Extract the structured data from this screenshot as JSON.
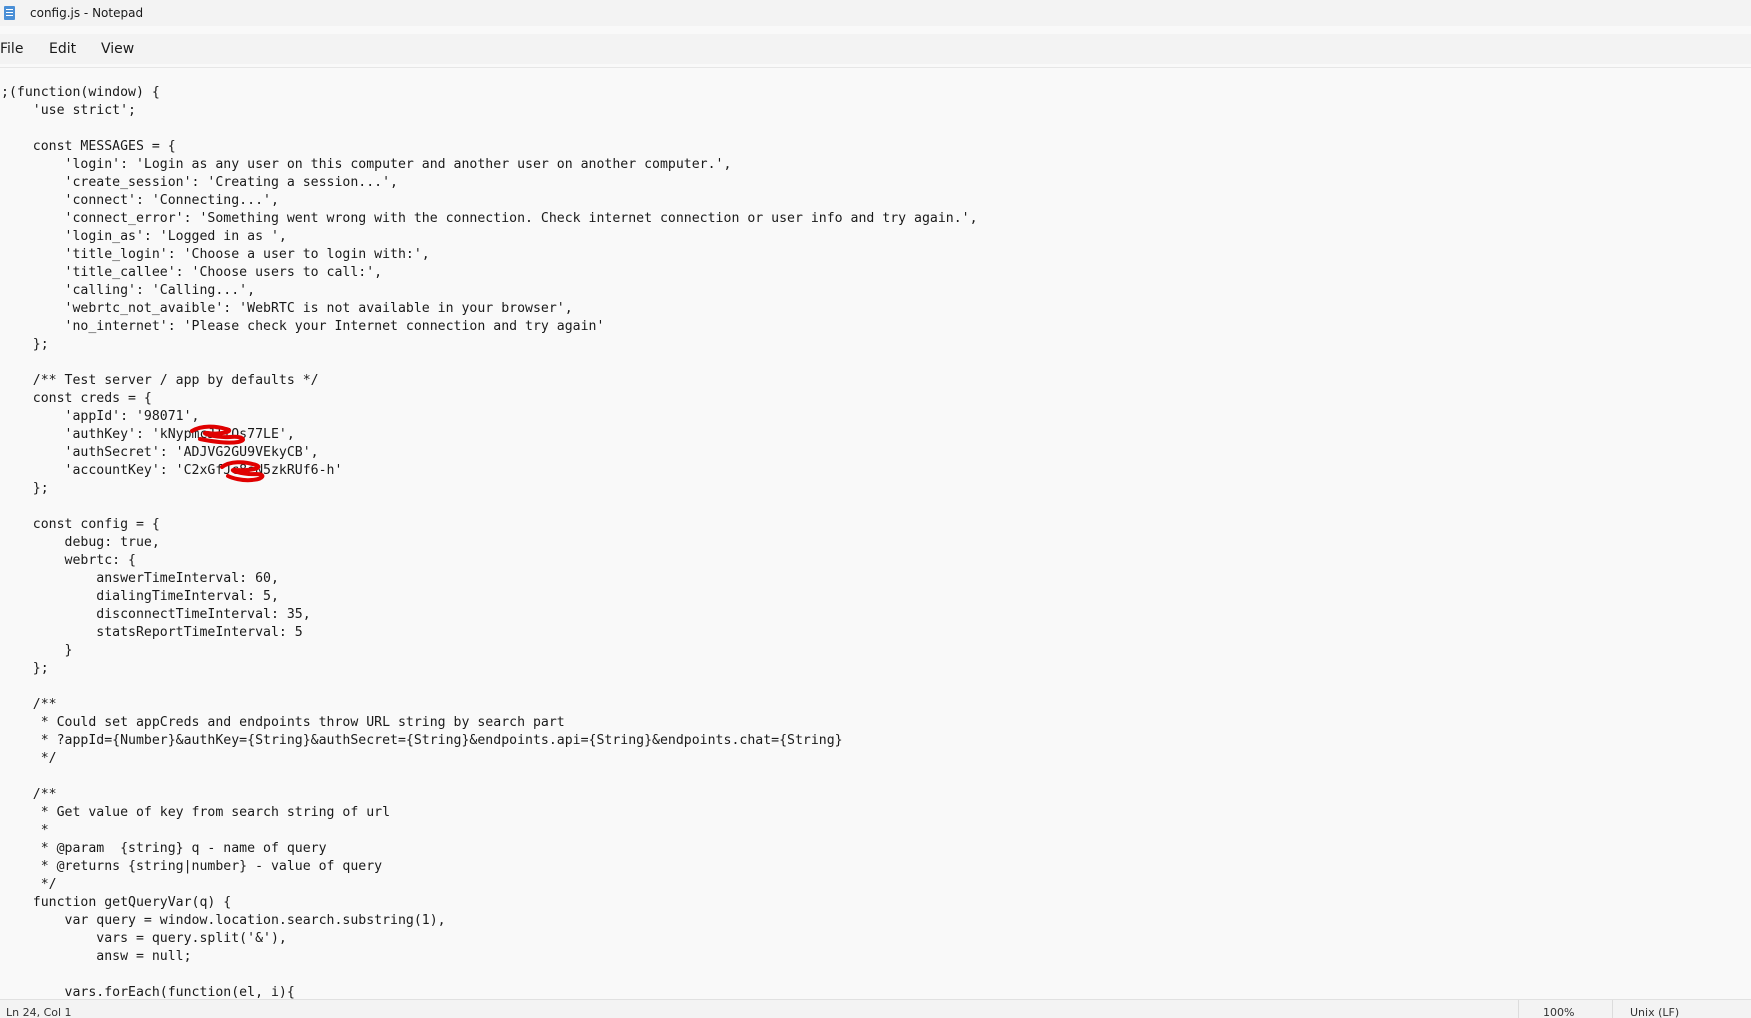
{
  "window": {
    "title": "config.js - Notepad"
  },
  "menu": {
    "file": "File",
    "edit": "Edit",
    "view": "View"
  },
  "editor": {
    "content": ";(function(window) {\n    'use strict';\n\n    const MESSAGES = {\n        'login': 'Login as any user on this computer and another user on another computer.',\n        'create_session': 'Creating a session...',\n        'connect': 'Connecting...',\n        'connect_error': 'Something went wrong with the connection. Check internet connection or user info and try again.',\n        'login_as': 'Logged in as ',\n        'title_login': 'Choose a user to login with:',\n        'title_callee': 'Choose users to call:',\n        'calling': 'Calling...',\n        'webrtc_not_avaible': 'WebRTC is not available in your browser',\n        'no_internet': 'Please check your Internet connection and try again'\n    };\n\n    /** Test server / app by defaults */\n    const creds = {\n        'appId': '98071',\n        'authKey': 'kNypmcJTfOs77LE',\n        'authSecret': 'ADJVG2GU9VEkyCB',\n        'accountKey': 'C2xGfJc8eN5zkRUf6-h'\n    };\n\n    const config = {\n        debug: true,\n        webrtc: {\n            answerTimeInterval: 60,\n            dialingTimeInterval: 5,\n            disconnectTimeInterval: 35,\n            statsReportTimeInterval: 5\n        }\n    };\n\n    /**\n     * Could set appCreds and endpoints throw URL string by search part\n     * ?appId={Number}&authKey={String}&authSecret={String}&endpoints.api={String}&endpoints.chat={String}\n     */\n\n    /**\n     * Get value of key from search string of url\n     *\n     * @param  {string} q - name of query\n     * @returns {string|number} - value of query\n     */\n    function getQueryVar(q) {\n        var query = window.location.search.substring(1),\n            vars = query.split('&'),\n            answ = null;\n\n        vars.forEach(function(el, i){"
  },
  "status": {
    "position": "Ln 24, Col 1",
    "zoom": "100%",
    "line_ending": "Unix (LF)"
  },
  "colors": {
    "redaction": "#e00000"
  }
}
